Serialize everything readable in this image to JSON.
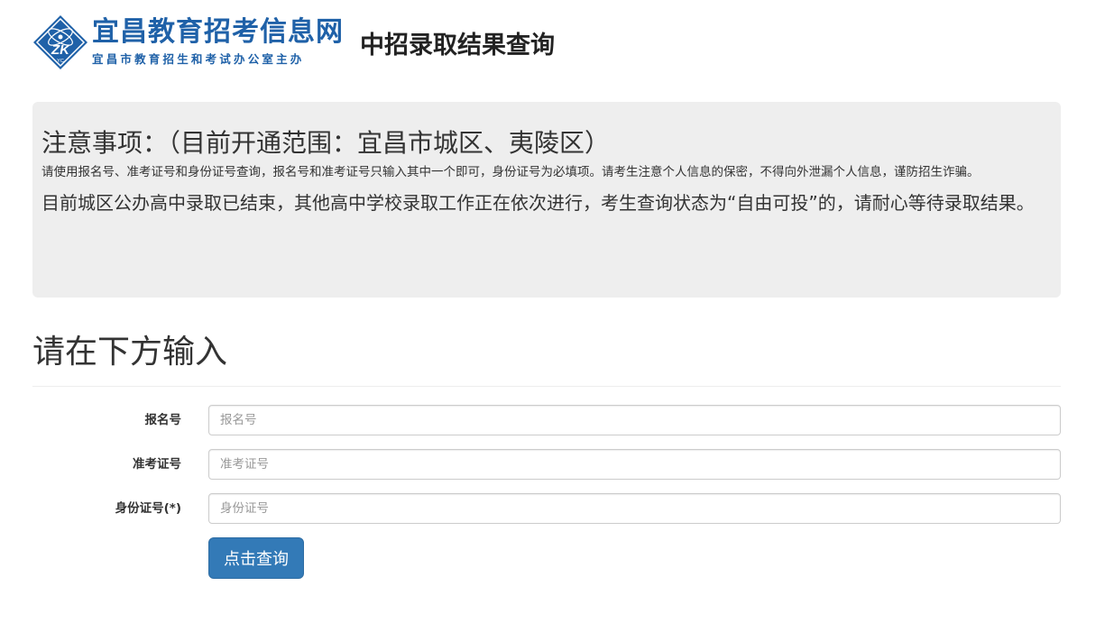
{
  "header": {
    "logo": {
      "title": "宜昌教育招考信息网",
      "subtitle": "宜昌市教育招生和考试办公室主办",
      "emblem_text": "ZK",
      "emblem_subtext": "YC",
      "emblem_icon": "atom-emblem-icon"
    },
    "page_title": "中招录取结果查询"
  },
  "notice": {
    "title": "注意事项：（目前开通范围：宜昌市城区、夷陵区）",
    "description": "请使用报名号、准考证号和身份证号查询，报名号和准考证号只输入其中一个即可，身份证号为必填项。请考生注意个人信息的保密，不得向外泄漏个人信息，谨防招生诈骗。",
    "status": "目前城区公办高中录取已结束，其他高中学校录取工作正在依次进行，考生查询状态为“自由可投”的，请耐心等待录取结果。"
  },
  "form": {
    "heading": "请在下方输入",
    "fields": [
      {
        "label": "报名号",
        "placeholder": "报名号",
        "value": ""
      },
      {
        "label": "准考证号",
        "placeholder": "准考证号",
        "value": ""
      },
      {
        "label": "身份证号(*)",
        "placeholder": "身份证号",
        "value": ""
      }
    ],
    "submit_label": "点击查询"
  },
  "colors": {
    "brand_blue": "#1f61a8",
    "button_blue": "#337ab7",
    "notice_background": "#eeeeee"
  }
}
